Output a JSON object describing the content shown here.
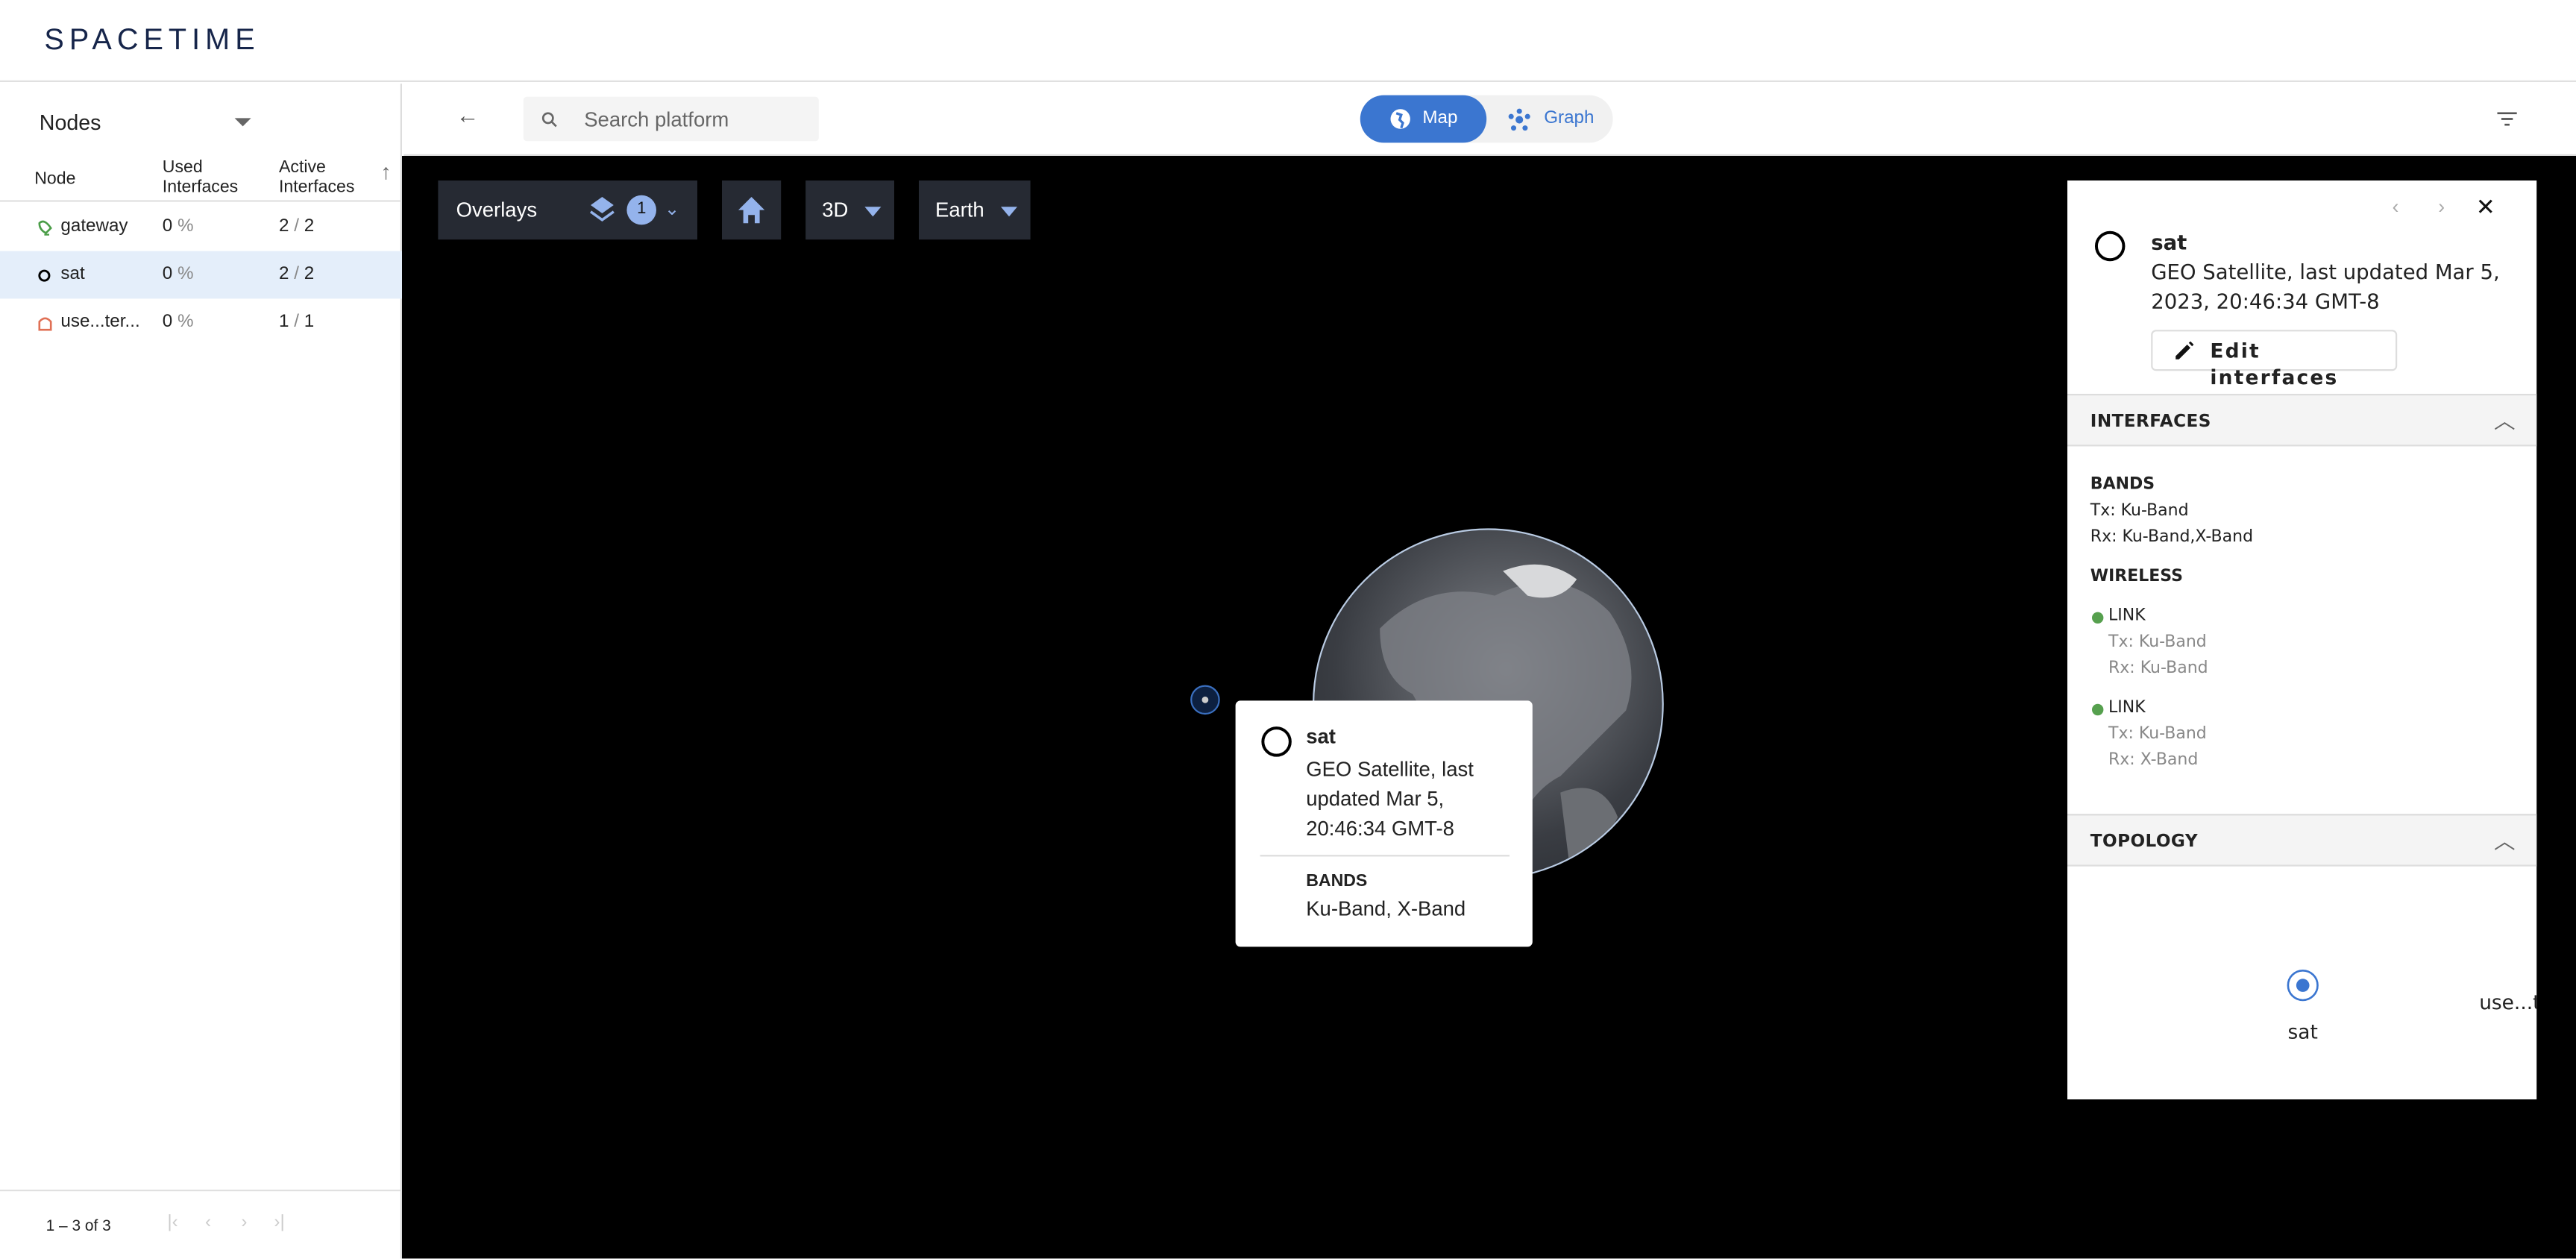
{
  "app": {
    "logo": "SPACETIME"
  },
  "left_panel": {
    "title": "Nodes",
    "columns": [
      "Node",
      "Used",
      "Interfaces",
      "Active",
      "Interfaces"
    ],
    "rows": [
      {
        "icon": "gateway-icon",
        "name": "gateway",
        "used": "0",
        "used_unit": "%",
        "active": "2",
        "active_total": "2",
        "selected": false
      },
      {
        "icon": "satellite-icon",
        "name": "sat",
        "used": "0",
        "used_unit": "%",
        "active": "2",
        "active_total": "2",
        "selected": true
      },
      {
        "icon": "user-terminal-icon",
        "name": "use...ter...",
        "used": "0",
        "used_unit": "%",
        "active": "1",
        "active_total": "1",
        "selected": false
      }
    ],
    "pagination": "1 – 3 of 3"
  },
  "toolbar": {
    "search_placeholder": "Search platform",
    "view_toggle": {
      "map": "Map",
      "graph": "Graph",
      "active": "Map"
    },
    "accent": "#3b76d0"
  },
  "map_controls": {
    "overlays": "Overlays",
    "overlay_count": "1",
    "view_mode": "3D",
    "body": "Earth"
  },
  "tooltip": {
    "name": "sat",
    "desc_lines": [
      "GEO Satellite, last",
      "updated Mar 5,",
      "20:46:34 GMT-8"
    ],
    "bands_label": "BANDS",
    "bands": "Ku-Band, X-Band"
  },
  "detail_panel": {
    "name": "sat",
    "desc_lines": [
      "GEO Satellite, last updated Mar 5,",
      "2023, 20:46:34 GMT-8"
    ],
    "edit_button": "Edit interfaces",
    "interfaces_header": "INTERFACES",
    "bands_label": "BANDS",
    "bands_tx": "Tx: Ku-Band",
    "bands_rx": "Rx: Ku-Band,X-Band",
    "wireless_label": "WIRELESS",
    "links": [
      {
        "label": "LINK",
        "tx": "Tx: Ku-Band",
        "rx": "Rx: Ku-Band",
        "status_color": "#56a04e"
      },
      {
        "label": "LINK",
        "tx": "Tx: Ku-Band",
        "rx": "Rx: X-Band",
        "status_color": "#56a04e"
      }
    ],
    "topology_header": "TOPOLOGY",
    "topology_nodes": [
      "sat",
      "use...t"
    ]
  }
}
